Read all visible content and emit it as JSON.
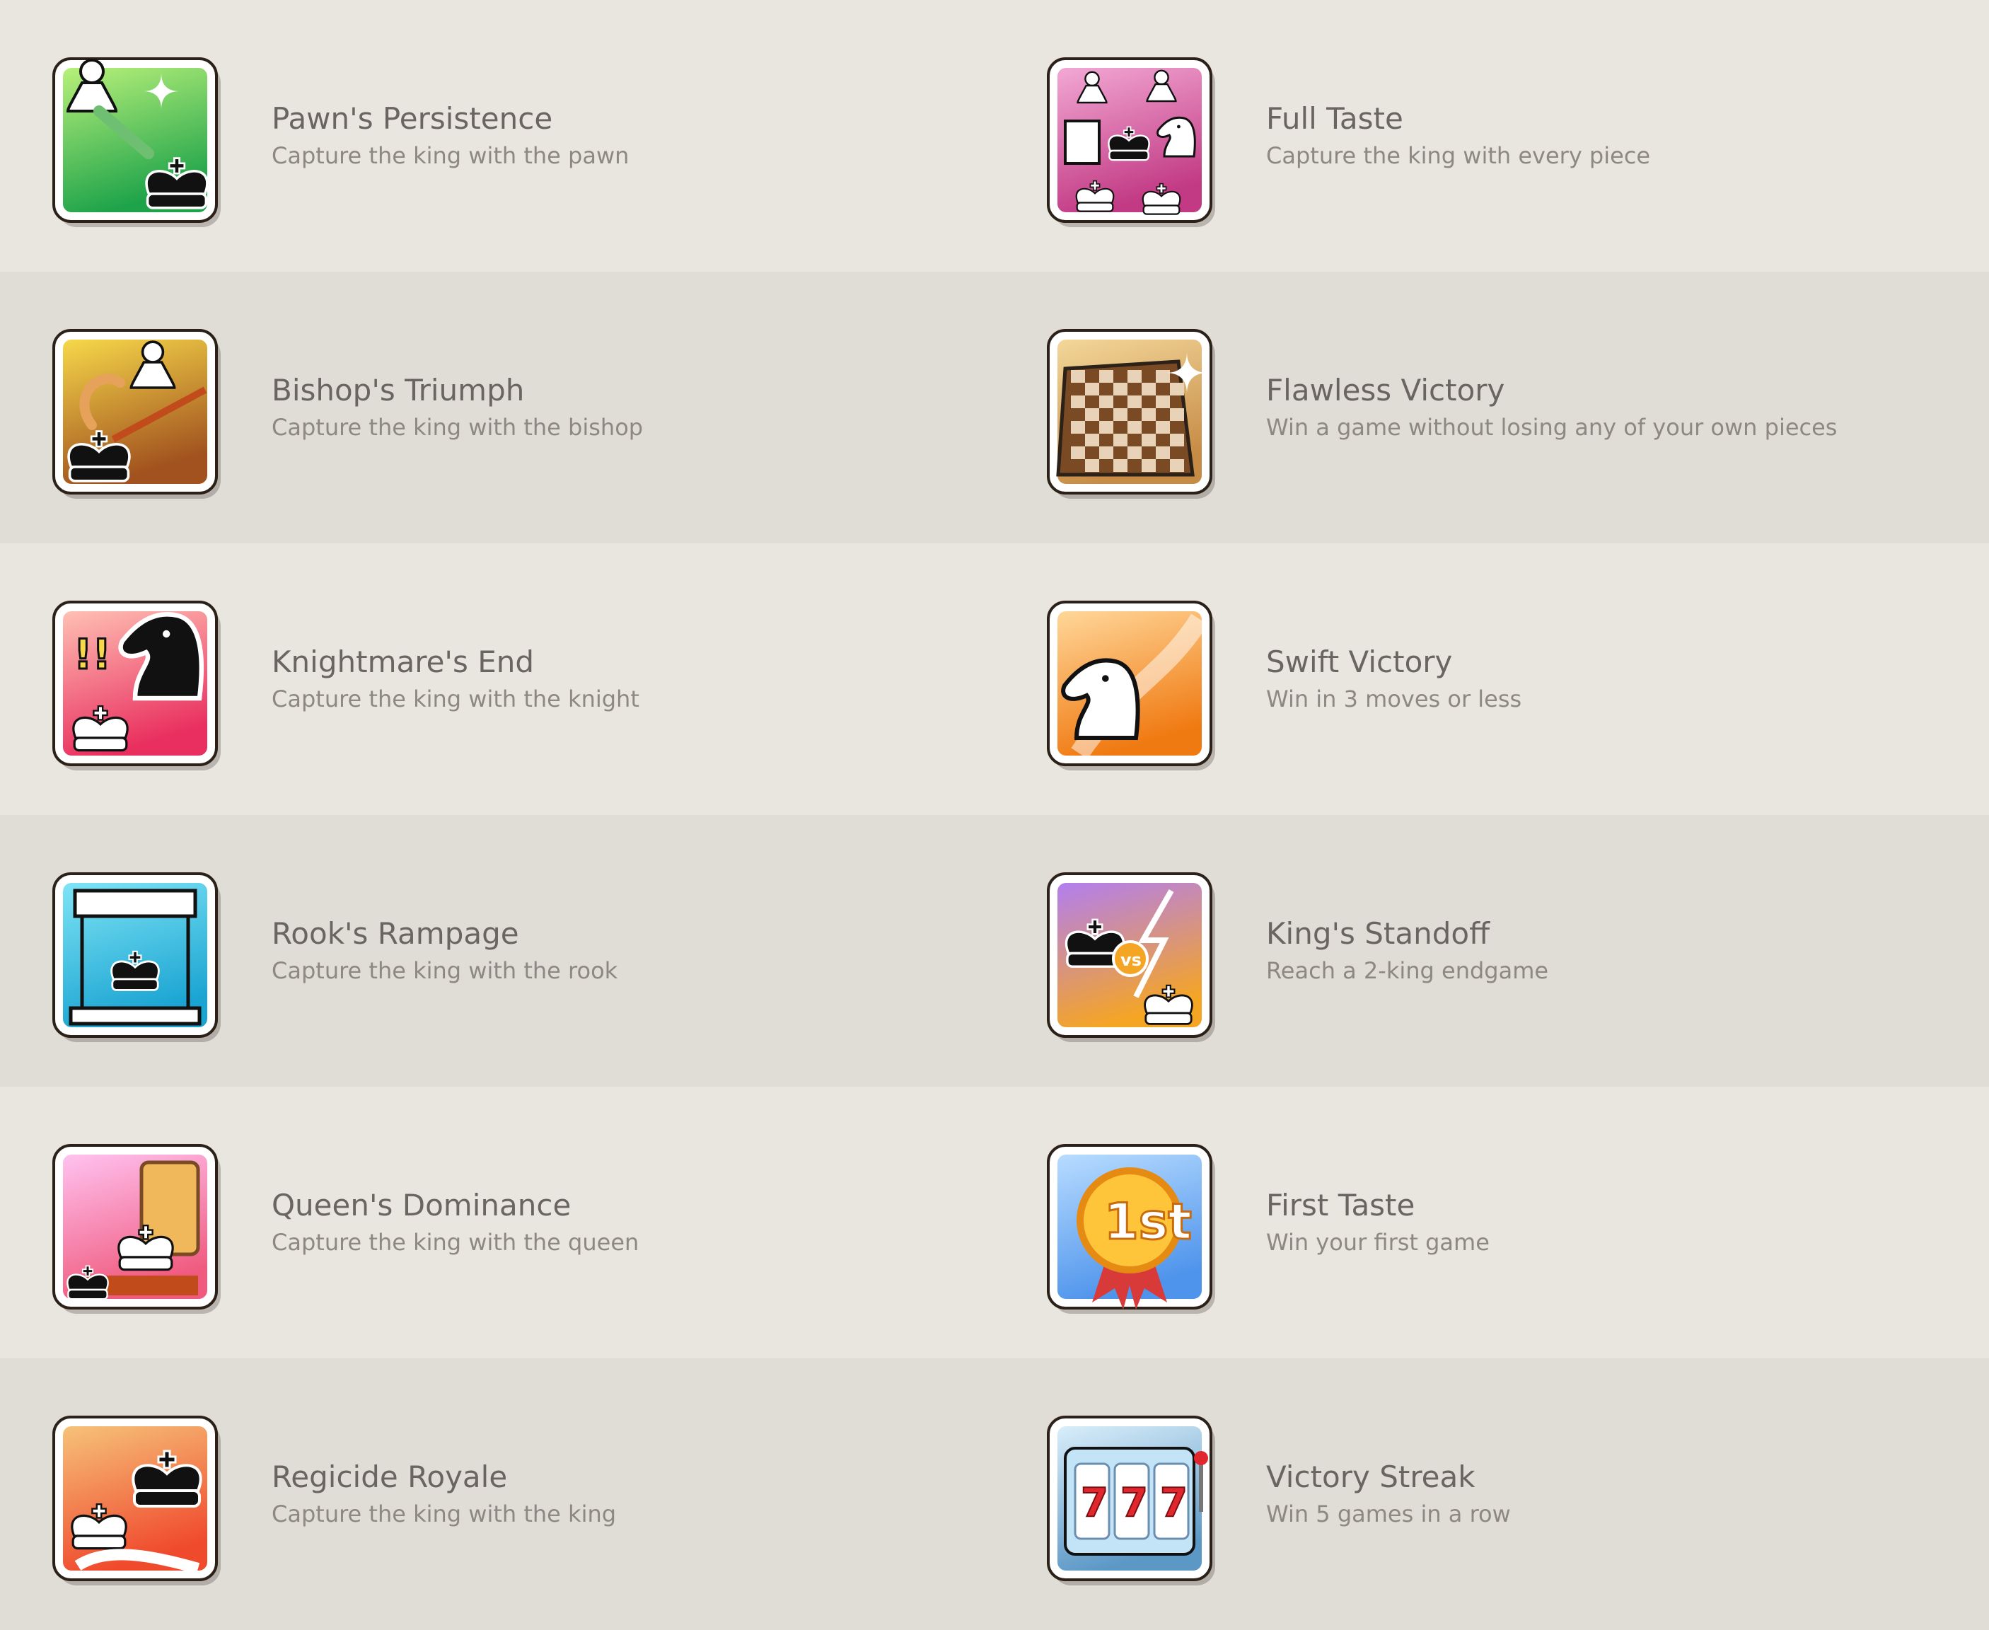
{
  "achievements": [
    {
      "id": "pawns-persistence",
      "title": "Pawn's Persistence",
      "description": "Capture the king with the pawn",
      "icon": "pawn-sword-icon",
      "colors": [
        "#b8f07a",
        "#1ea34a"
      ]
    },
    {
      "id": "full-taste",
      "title": "Full Taste",
      "description": "Capture the king with every piece",
      "icon": "all-pieces-icon",
      "colors": [
        "#f2a8d4",
        "#c23a84"
      ]
    },
    {
      "id": "bishops-triumph",
      "title": "Bishop's Triumph",
      "description": "Capture the king with the bishop",
      "icon": "bishop-crozier-icon",
      "colors": [
        "#f6d84a",
        "#a1521e"
      ]
    },
    {
      "id": "flawless-victory",
      "title": "Flawless Victory",
      "description": "Win a game without losing any of your own pieces",
      "icon": "chessboard-icon",
      "colors": [
        "#f3d79a",
        "#c68b45"
      ]
    },
    {
      "id": "knightmares-end",
      "title": "Knightmare's End",
      "description": "Capture the king with the knight",
      "icon": "knight-rearing-icon",
      "colors": [
        "#ffc0b4",
        "#e92f5f"
      ]
    },
    {
      "id": "swift-victory",
      "title": "Swift Victory",
      "description": "Win in 3 moves or less",
      "icon": "knight-speed-icon",
      "colors": [
        "#ffd79a",
        "#f07a12"
      ]
    },
    {
      "id": "rooks-rampage",
      "title": "Rook's Rampage",
      "description": "Capture the king with the rook",
      "icon": "rook-cage-icon",
      "colors": [
        "#7fe4f5",
        "#1aa4d2"
      ]
    },
    {
      "id": "kings-standoff",
      "title": "King's Standoff",
      "description": "Reach a 2-king endgame",
      "icon": "kings-versus-icon",
      "colors": [
        "#b27ef0",
        "#f5a524"
      ]
    },
    {
      "id": "queens-dominance",
      "title": "Queen's Dominance",
      "description": "Capture the king with the queen",
      "icon": "queen-throne-icon",
      "colors": [
        "#ffc2f0",
        "#f05a7e"
      ]
    },
    {
      "id": "first-taste",
      "title": "First Taste",
      "description": "Win your first game",
      "icon": "first-medal-icon",
      "colors": [
        "#b8dcff",
        "#4f94ec"
      ]
    },
    {
      "id": "regicide-royale",
      "title": "Regicide Royale",
      "description": "Capture the king with the king",
      "icon": "king-vs-king-icon",
      "colors": [
        "#f6c27a",
        "#f04a2d"
      ]
    },
    {
      "id": "victory-streak",
      "title": "Victory Streak",
      "description": "Win 5 games in a row",
      "icon": "slot-machine-icon",
      "colors": [
        "#d9eefa",
        "#5c98c6"
      ],
      "reels": [
        "7",
        "7",
        "7"
      ]
    }
  ]
}
